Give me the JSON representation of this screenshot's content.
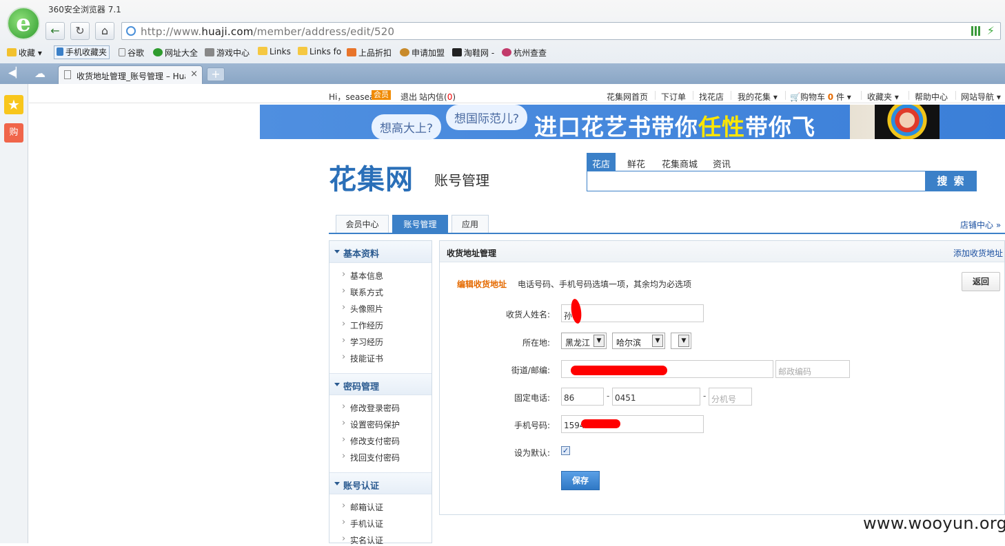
{
  "browser": {
    "title": "360安全浏览器 7.1",
    "url_prefix": "http://www.",
    "url_domain": "huaji.com",
    "url_path": "/member/address/edit/520",
    "bookmarks": [
      "收藏",
      "手机收藏夹",
      "谷歌",
      "网址大全",
      "游戏中心",
      "Links",
      "Links fo",
      "上品折扣",
      "申请加盟",
      "淘鞋网 -",
      "杭州查查"
    ],
    "tab_title": "收货地址管理_账号管理 – Hua",
    "tab_close": "×",
    "new_tab": "+",
    "buy_label": "购"
  },
  "sitebar": {
    "greeting": "Hi，seasea",
    "badge": "会员",
    "logout": "退出",
    "messages": "站内信(",
    "msg_count": "0",
    "msg_close": ")",
    "links": [
      "花集网首页",
      "下订单",
      "找花店",
      "我的花集 ▾"
    ],
    "cart": "购物车",
    "cart_count": "0",
    "cart_unit": "件 ▾",
    "links2": [
      "收藏夹 ▾",
      "帮助中心",
      "网站导航 ▾"
    ]
  },
  "banner": {
    "bubble1": "想高大上?",
    "bubble2": "想国际范儿?",
    "slogan_a": "进口花艺书带你",
    "slogan_b": "任性",
    "slogan_c": "带你飞",
    "accent": "#ffe600"
  },
  "header": {
    "logo": "花集网",
    "subtitle": "账号管理",
    "search_tabs": [
      "花店",
      "鲜花",
      "花集商城",
      "资讯"
    ],
    "search_button": "搜 索"
  },
  "main_tabs": [
    "会员中心",
    "账号管理",
    "应用"
  ],
  "shop_center": "店铺中心 »",
  "left_menu": [
    {
      "title": "基本资料",
      "items": [
        "基本信息",
        "联系方式",
        "头像照片",
        "工作经历",
        "学习经历",
        "技能证书"
      ]
    },
    {
      "title": "密码管理",
      "items": [
        "修改登录密码",
        "设置密码保护",
        "修改支付密码",
        "找回支付密码"
      ]
    },
    {
      "title": "账号认证",
      "items": [
        "邮箱认证",
        "手机认证",
        "实名认证"
      ]
    }
  ],
  "panel": {
    "title": "收货地址管理",
    "add_link": "添加收货地址",
    "edit_label": "编辑收货地址",
    "edit_hint": "电话号码、手机号码选填一项，其余均为必选项",
    "back_button": "返回",
    "fields": {
      "name_label": "收货人姓名:",
      "name_value": "孙",
      "location_label": "所在地:",
      "province": "黑龙江",
      "city": "哈尔滨",
      "district": "",
      "street_label": "街道/邮编:",
      "street_value": "",
      "postcode_placeholder": "邮政编码",
      "phone_label": "固定电话:",
      "phone_country": "86",
      "phone_area": "0451",
      "phone_ext_placeholder": "分机号",
      "mobile_label": "手机号码:",
      "mobile_value": "15945",
      "default_label": "设为默认:",
      "default_checked": "✓"
    },
    "save_button": "保存"
  },
  "watermark": "www.wooyun.org",
  "colors": {
    "primary": "#3b80c8",
    "orange": "#e56a00",
    "link": "#1a4fa0"
  }
}
